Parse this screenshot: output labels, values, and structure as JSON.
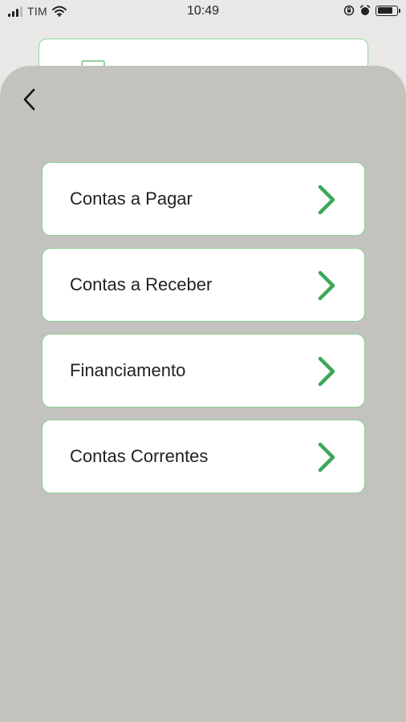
{
  "status_bar": {
    "carrier": "TIM",
    "time": "10:49",
    "battery_level": 0.85
  },
  "icons": {
    "back": "chevron-left-icon",
    "item_arrow": "chevron-right-icon",
    "wifi": "wifi-icon",
    "lock_rotation": "orientation-lock-icon",
    "alarm": "alarm-icon",
    "battery": "battery-icon"
  },
  "colors": {
    "accent": "#3aa85a",
    "card_border": "#86d08f",
    "sheet_background": "#c3c2be"
  },
  "menu": {
    "items": [
      {
        "label": "Contas a Pagar"
      },
      {
        "label": "Contas a Receber"
      },
      {
        "label": "Financiamento"
      },
      {
        "label": "Contas Correntes"
      }
    ]
  }
}
